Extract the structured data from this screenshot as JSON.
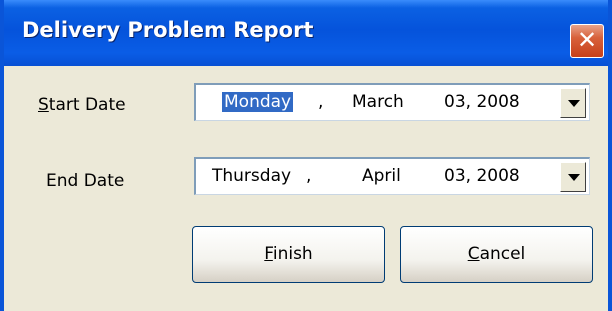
{
  "window": {
    "title": "Delivery Problem Report",
    "close_glyph": "✕"
  },
  "start": {
    "label_mnemonic": "S",
    "label_rest": "tart Date",
    "weekday": "Monday",
    "comma": ",",
    "month": "March",
    "day_year": "03, 2008"
  },
  "end": {
    "label": "End Date",
    "weekday": "Thursday",
    "comma": ",",
    "month": "April",
    "day_year": "03, 2008"
  },
  "buttons": {
    "finish_mnemonic": "F",
    "finish_rest": "inish",
    "cancel_mnemonic": "C",
    "cancel_rest": "ancel"
  },
  "colors": {
    "titlebar": "#0553DB",
    "dialog_bg": "#ECE9D8",
    "selection": "#316AC5",
    "close_button": "#C7401A"
  }
}
